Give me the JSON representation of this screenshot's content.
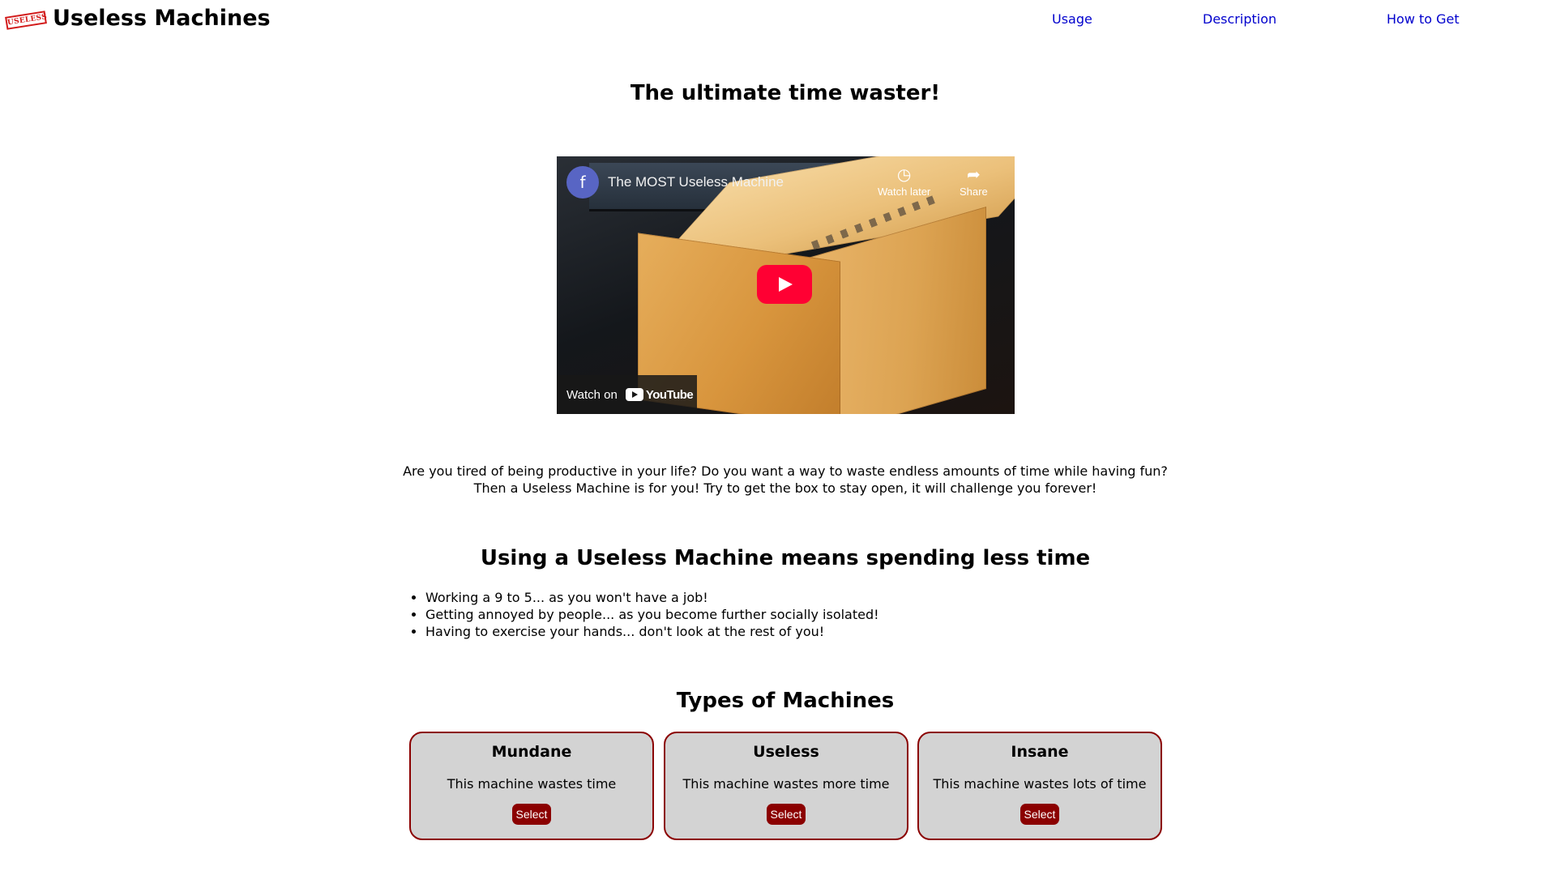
{
  "header": {
    "logo_text": "USELESS",
    "site_title": "Useless Machines",
    "nav": {
      "usage": "Usage",
      "description": "Description",
      "how_to_get": "How to Get"
    }
  },
  "hero": {
    "heading": "The ultimate time waster!"
  },
  "video": {
    "channel_initial": "f",
    "title": "The MOST Useless Machine",
    "watch_later": "Watch later",
    "share": "Share",
    "watch_on": "Watch on",
    "youtube": "YouTube"
  },
  "intro": {
    "line1": "Are you tired of being productive in your life? Do you want a way to waste endless amounts of time while having fun?",
    "line2": "Then a Useless Machine is for you! Try to get the box to stay open, it will challenge you forever!"
  },
  "benefits": {
    "heading": "Using a Useless Machine means spending less time",
    "items": [
      "Working a 9 to 5... as you won't have a job!",
      "Getting annoyed by people... as you become further socially isolated!",
      "Having to exercise your hands... don't look at the rest of you!"
    ]
  },
  "types": {
    "heading": "Types of Machines",
    "cards": [
      {
        "name": "Mundane",
        "description": "This machine wastes time",
        "button": "Select"
      },
      {
        "name": "Useless",
        "description": "This machine wastes more time",
        "button": "Select"
      },
      {
        "name": "Insane",
        "description": "This machine wastes lots of time",
        "button": "Select"
      }
    ]
  },
  "colors": {
    "accent": "#8b0000",
    "card_background": "#d3d3d3",
    "link": "#0000cd",
    "logo_red": "#d21a1a"
  }
}
